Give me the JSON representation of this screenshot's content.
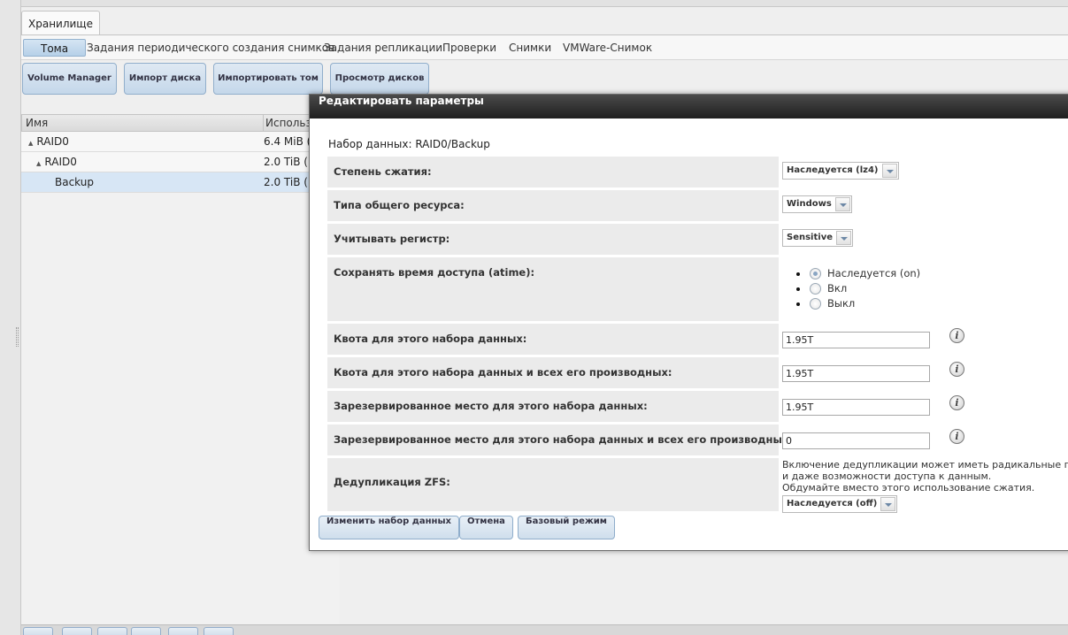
{
  "main_tab": "Хранилище",
  "subtabs": [
    "Тома",
    "Задания периодического создания снимков",
    "Задания репликации",
    "Проверки",
    "Снимки",
    "VMWare-Снимок"
  ],
  "toolbar": {
    "volume_manager": "Volume Manager",
    "import_disk": "Импорт диска",
    "import_volume": "Импортировать том",
    "view_disks": "Просмотр дисков"
  },
  "grid": {
    "columns": [
      "Имя",
      "Использо"
    ],
    "rows": [
      {
        "name": "RAID0",
        "used": "6.4 MiB (",
        "level": 0,
        "expander": "▲"
      },
      {
        "name": "RAID0",
        "used": "2.0 TiB (",
        "level": 1,
        "expander": "▲"
      },
      {
        "name": "Backup",
        "used": "2.0 TiB (",
        "level": 2,
        "expander": ""
      }
    ]
  },
  "dialog": {
    "title": "Редактировать параметры",
    "dataset_line": "Набор данных: RAID0/Backup",
    "compression": {
      "label": "Степень сжатия:",
      "value": "Наследуется (lz4)"
    },
    "share_type": {
      "label": "Типа общего ресурса:",
      "value": "Windows"
    },
    "case_sensitivity": {
      "label": "Учитывать регистр:",
      "value": "Sensitive"
    },
    "atime": {
      "label": "Сохранять время доступа (atime):",
      "options": [
        "Наследуется (on)",
        "Вкл",
        "Выкл"
      ],
      "selected": 0
    },
    "quota": {
      "label": "Квота для этого набора данных:",
      "value": "1.95T"
    },
    "quota_children": {
      "label": "Квота для этого набора данных и всех его производных:",
      "value": "1.95T"
    },
    "reserved": {
      "label": "Зарезервированное место для этого набора данных:",
      "value": "1.95T"
    },
    "reserved_children": {
      "label": "Зарезервированное место для этого набора данных и всех его производных:",
      "value": "0"
    },
    "dedup": {
      "label": "Дедупликация ZFS:",
      "note_line1": "Включение дедупликации может иметь радикальные п",
      "note_line2": "и даже возможности доступа к данным.",
      "note_line3": "Обдумайте вместо этого использование сжатия.",
      "value": "Наследуется (off)"
    },
    "info_glyph": "i",
    "buttons": {
      "modify": "Изменить набор данных",
      "cancel": "Отмена",
      "basic_mode": "Базовый режим"
    }
  }
}
